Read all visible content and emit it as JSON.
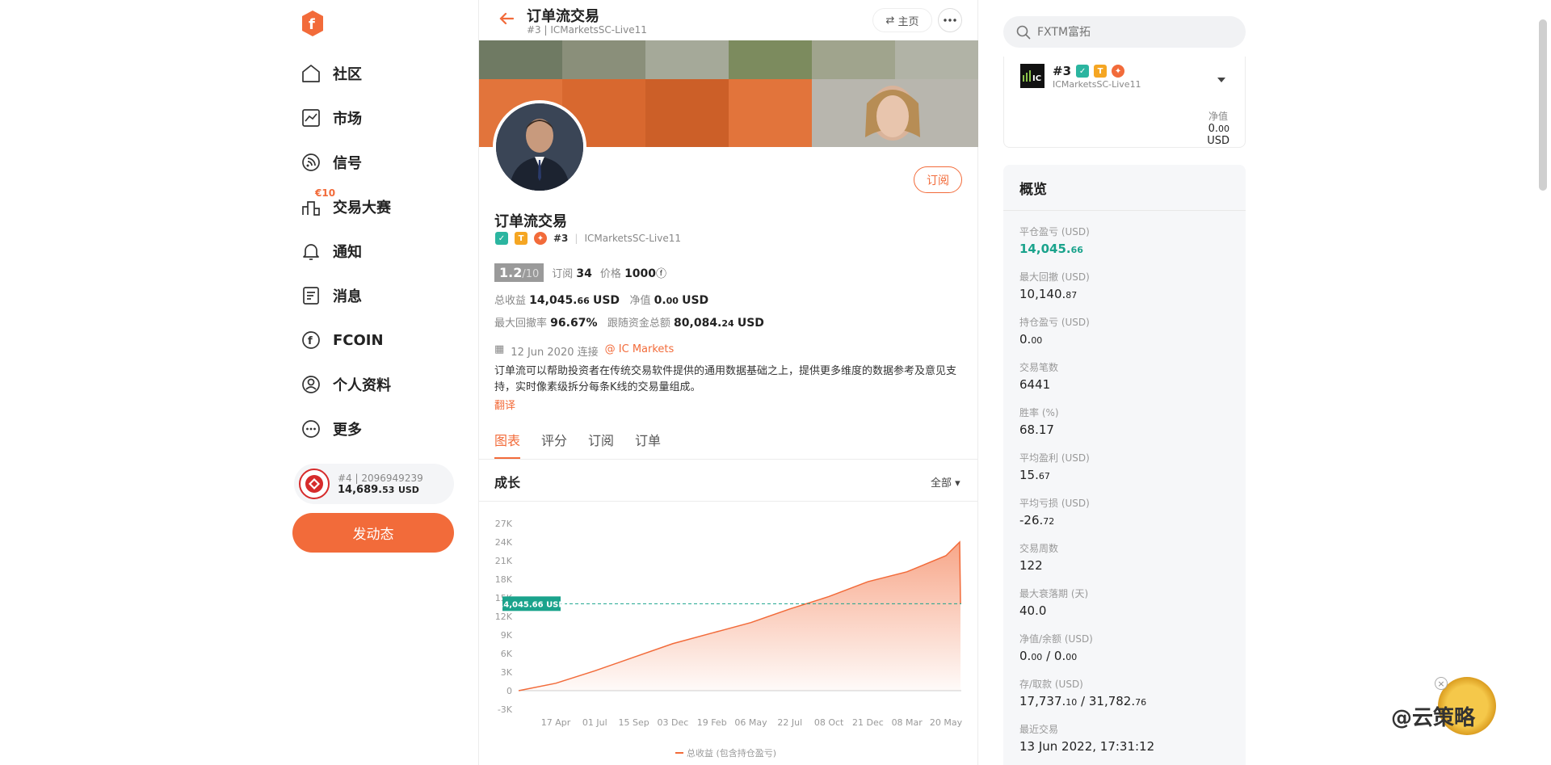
{
  "sidebar": {
    "items": [
      {
        "label": "社区",
        "icon": "home-icon"
      },
      {
        "label": "市场",
        "icon": "chart-icon"
      },
      {
        "label": "信号",
        "icon": "signal-icon"
      },
      {
        "label": "交易大赛",
        "icon": "contest-icon",
        "badge": "€10"
      },
      {
        "label": "通知",
        "icon": "bell-icon"
      },
      {
        "label": "消息",
        "icon": "message-icon"
      },
      {
        "label": "FCOIN",
        "icon": "fcoin-icon"
      },
      {
        "label": "个人资料",
        "icon": "profile-icon"
      },
      {
        "label": "更多",
        "icon": "more-icon"
      }
    ],
    "account": {
      "rank": "#4",
      "id": "2096949239",
      "balance_main": "14,689.",
      "balance_dec": "53",
      "currency": "USD"
    },
    "post_label": "发动态"
  },
  "header": {
    "title": "订单流交易",
    "rank": "#3",
    "server": "ICMarketsSC-Live11",
    "home_label": "主页"
  },
  "profile": {
    "name": "订单流交易",
    "rank": "#3",
    "server": "ICMarketsSC-Live11",
    "subscribe_label": "订阅",
    "score": "1.2",
    "score_max": "/10",
    "subs_label": "订阅",
    "subs": "34",
    "price_label": "价格",
    "price": "1000",
    "total_profit_label": "总收益",
    "total_profit_main": "14,045.",
    "total_profit_dec": "66",
    "currency": "USD",
    "equity_label": "净值",
    "equity_main": "0.",
    "equity_dec": "00",
    "max_dd_label": "最大回撤率",
    "max_dd": "96.67%",
    "follow_label": "跟随资金总额",
    "follow_main": "80,084.",
    "follow_dec": "24",
    "joined": "12 Jun 2020 连接",
    "broker": "IC Markets",
    "description": "订单流可以帮助投资者在传统交易软件提供的通用数据基础之上，提供更多维度的数据参考及意见支持，实时像素级拆分每条K线的交易量组成。",
    "translate": "翻译"
  },
  "tabs": [
    {
      "label": "图表",
      "active": true
    },
    {
      "label": "评分",
      "active": false
    },
    {
      "label": "订阅",
      "active": false
    },
    {
      "label": "订单",
      "active": false
    }
  ],
  "growth": {
    "title": "成长",
    "filter": "全部"
  },
  "chart_data": {
    "type": "area",
    "title": "",
    "ylim": [
      -3000,
      27000
    ],
    "y_ticks": [
      "27K",
      "24K",
      "21K",
      "18K",
      "15K",
      "12K",
      "9K",
      "6K",
      "3K",
      "0",
      "-3K"
    ],
    "x_ticks": [
      "17 Apr",
      "01 Jul",
      "15 Sep",
      "03 Dec",
      "19 Feb",
      "06 May",
      "22 Jul",
      "08 Oct",
      "21 Dec",
      "08 Mar",
      "20 May"
    ],
    "series": [
      {
        "name": "总收益 (包含持仓盈亏)",
        "color": "#f26b3a",
        "x": [
          "03 Feb",
          "17 Apr",
          "01 Jul",
          "15 Sep",
          "03 Dec",
          "19 Feb",
          "06 May",
          "22 Jul",
          "08 Oct",
          "21 Dec",
          "08 Mar",
          "20 May",
          "03 Jun",
          "13 Jun"
        ],
        "values": [
          0,
          1200,
          3200,
          5400,
          7600,
          9300,
          11000,
          13200,
          15200,
          17600,
          19200,
          21800,
          24000,
          14045.66
        ]
      }
    ],
    "reference": {
      "value": 14045.66,
      "label": "14,045.66 USD",
      "color": "#1aa38c"
    }
  },
  "search": {
    "placeholder": "FXTM富拓"
  },
  "account_panel": {
    "rank": "#3",
    "server": "ICMarketsSC-Live11",
    "equity_label": "净值",
    "equity_main": "0.",
    "equity_dec": "00",
    "currency": "USD"
  },
  "overview": {
    "title": "概览",
    "stats": [
      {
        "label": "平仓盈亏 (USD)",
        "main": "14,045.",
        "dec": "66",
        "green": true
      },
      {
        "label": "最大回撤 (USD)",
        "main": "10,140.",
        "dec": "87"
      },
      {
        "label": "持仓盈亏 (USD)",
        "main": "0.",
        "dec": "00"
      },
      {
        "label": "交易笔数",
        "main": "6441",
        "dec": ""
      },
      {
        "label": "胜率 (%)",
        "main": "68.17",
        "dec": ""
      },
      {
        "label": "平均盈利 (USD)",
        "main": "15.",
        "dec": "67"
      },
      {
        "label": "平均亏损 (USD)",
        "main": "-26.",
        "dec": "72"
      },
      {
        "label": "交易周数",
        "main": "122",
        "dec": ""
      },
      {
        "label": "最大衰落期 (天)",
        "main": "40.0",
        "dec": ""
      },
      {
        "label": "净值/余额 (USD)",
        "main": "0.",
        "dec": "00",
        "main2": "0.",
        "dec2": "00"
      },
      {
        "label": "存/取款 (USD)",
        "main": "17,737.",
        "dec": "10",
        "main2": "31,782.",
        "dec2": "76"
      },
      {
        "label": "最近交易",
        "main": "13 Jun 2022, 17:31:12",
        "dec": ""
      }
    ]
  },
  "watermark": {
    "text": "@云策略"
  },
  "colors": {
    "accent": "#f26b3a",
    "green": "#1aa38c"
  }
}
